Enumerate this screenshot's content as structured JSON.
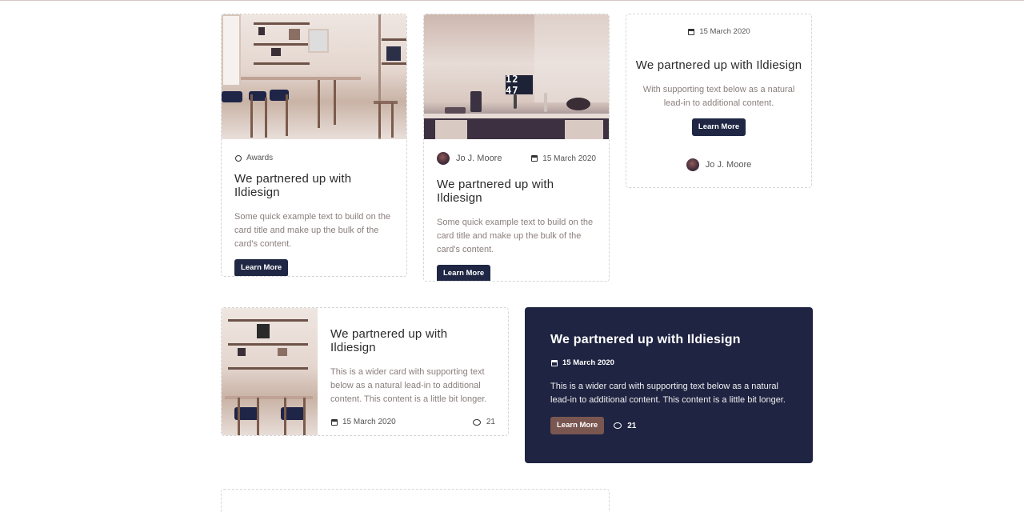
{
  "cards": {
    "card1": {
      "category": "Awards",
      "title": "We partnered up with Ildiesign",
      "text": "Some quick example text to build on the card title and make up the bulk of the card's content.",
      "button": "Learn More"
    },
    "card2": {
      "clock": "12 47",
      "author": "Jo J. Moore",
      "date": "15 March 2020",
      "title": "We partnered up with Ildiesign",
      "text": "Some quick example text to build on the card title and make up the bulk of the card's content.",
      "button": "Learn More"
    },
    "card3": {
      "date": "15 March 2020",
      "title": "We partnered up with Ildiesign",
      "text": "With supporting text below as a natural lead-in to additional content.",
      "button": "Learn More",
      "author": "Jo J. Moore"
    },
    "card4": {
      "title": "We partnered up with Ildiesign",
      "text": "This is a wider card with supporting text below as a natural lead-in to additional content. This content is a little bit longer.",
      "date": "15 March 2020",
      "comments": "21"
    },
    "card5": {
      "title": "We partnered up with Ildiesign",
      "date": "15 March 2020",
      "text": "This is a wider card with supporting text below as a natural lead-in to additional content. This content is a little bit longer.",
      "button": "Learn More",
      "comments": "21"
    }
  },
  "colors": {
    "primary_dark": "#1f2744",
    "accent_brown": "#7a5650",
    "border": "#d6d6d6"
  }
}
